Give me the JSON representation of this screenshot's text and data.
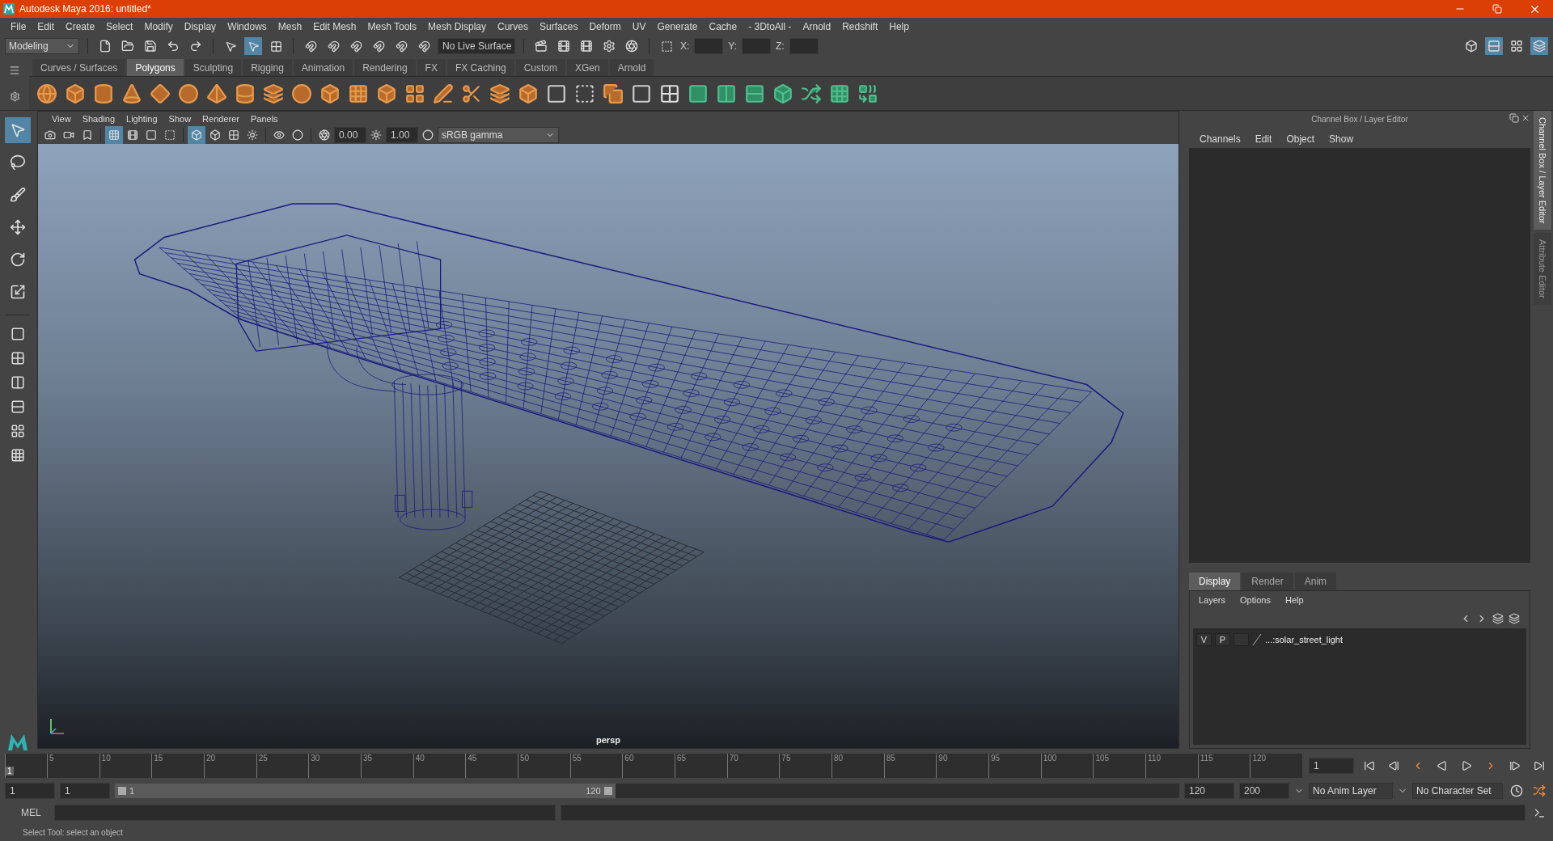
{
  "window": {
    "title": "Autodesk Maya 2016: untitled*"
  },
  "menu_bar": [
    "File",
    "Edit",
    "Create",
    "Select",
    "Modify",
    "Display",
    "Windows",
    "Mesh",
    "Edit Mesh",
    "Mesh Tools",
    "Mesh Display",
    "Curves",
    "Surfaces",
    "Deform",
    "UV",
    "Generate",
    "Cache",
    "- 3DtoAll -",
    "Arnold",
    "Redshift",
    "Help"
  ],
  "status_line": {
    "mode": "Modeling",
    "live_surface": "No Live Surface",
    "x_label": "X:",
    "y_label": "Y:",
    "z_label": "Z:"
  },
  "shelf_tabs": [
    {
      "label": "Curves / Surfaces",
      "selected": false
    },
    {
      "label": "Polygons",
      "selected": true
    },
    {
      "label": "Sculpting",
      "selected": false
    },
    {
      "label": "Rigging",
      "selected": false
    },
    {
      "label": "Animation",
      "selected": false
    },
    {
      "label": "Rendering",
      "selected": false
    },
    {
      "label": "FX",
      "selected": false
    },
    {
      "label": "FX Caching",
      "selected": false
    },
    {
      "label": "Custom",
      "selected": false
    },
    {
      "label": "XGen",
      "selected": false
    },
    {
      "label": "Arnold",
      "selected": false
    }
  ],
  "toolbox": [
    {
      "kind": "select",
      "selected": true
    },
    {
      "kind": "lasso",
      "selected": false
    },
    {
      "kind": "paint",
      "selected": false
    },
    {
      "kind": "move",
      "selected": false
    },
    {
      "kind": "rotate",
      "selected": false
    },
    {
      "kind": "scale",
      "selected": false
    }
  ],
  "viewport": {
    "menu": [
      "View",
      "Shading",
      "Lighting",
      "Show",
      "Renderer",
      "Panels"
    ],
    "exposure": "0.00",
    "gamma": "1.00",
    "color_space": "sRGB gamma",
    "camera": "persp"
  },
  "channel_box": {
    "title": "Channel Box / Layer Editor",
    "menu": [
      "Channels",
      "Edit",
      "Object",
      "Show"
    ]
  },
  "layer_editor": {
    "tabs": [
      {
        "label": "Display",
        "selected": true
      },
      {
        "label": "Render",
        "selected": false
      },
      {
        "label": "Anim",
        "selected": false
      }
    ],
    "menu": [
      "Layers",
      "Options",
      "Help"
    ],
    "layers": [
      {
        "visible": "V",
        "playback": "P",
        "name": "...:solar_street_light"
      }
    ]
  },
  "side_tabs": [
    {
      "label": "Channel Box / Layer Editor",
      "selected": true
    },
    {
      "label": "Attribute Editor",
      "selected": false
    }
  ],
  "timeline": {
    "start_label": "1",
    "level": 0,
    "ticks": [
      "5",
      "10",
      "15",
      "20",
      "25",
      "30",
      "35",
      "40",
      "45",
      "50",
      "55",
      "60",
      "65",
      "70",
      "75",
      "80",
      "85",
      "90",
      "95",
      "100",
      "105",
      "110",
      "115",
      "120"
    ],
    "current_frame": "1"
  },
  "range": {
    "start": "1",
    "playback_start": "1",
    "slider_start": "1",
    "slider_end": "120",
    "level": 0.47,
    "playback_end": "120",
    "end": "200",
    "anim_layer": "No Anim Layer",
    "character_set": "No Character Set"
  },
  "command_line": {
    "label": "MEL"
  },
  "help_line": "Select Tool: select an object"
}
